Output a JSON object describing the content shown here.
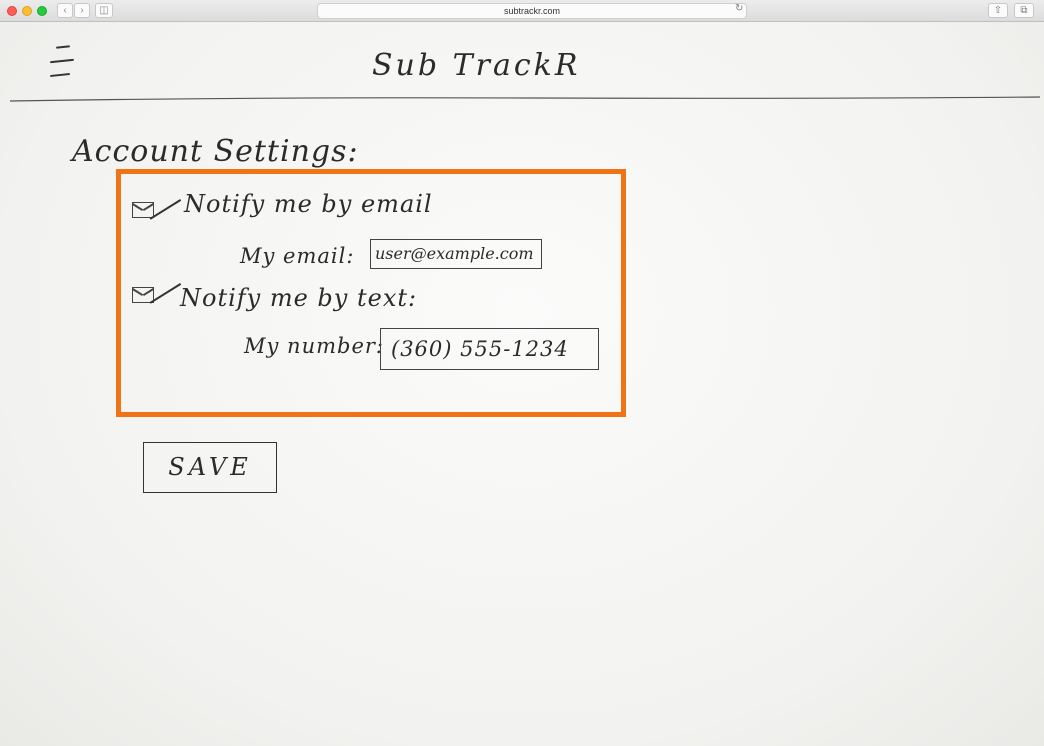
{
  "browser": {
    "url": "subtrackr.com",
    "back_icon": "‹",
    "forward_icon": "›",
    "sidebar_icon": "◫",
    "reload_icon": "↻",
    "share_icon": "⇧",
    "tabs_icon": "⧉"
  },
  "header": {
    "menu_icon": "hamburger-menu-icon",
    "title": "Sub TrackR"
  },
  "settings": {
    "title": "Account Settings:",
    "email_option": {
      "label": "Notify me by email",
      "checked": true,
      "field_label": "My email:",
      "value": "user@example.com"
    },
    "text_option": {
      "label": "Notify me by text:",
      "checked": true,
      "field_label": "My number:",
      "value": "(360) 555-1234"
    },
    "highlight_color": "#f07416"
  },
  "actions": {
    "save_label": "SAVE"
  }
}
